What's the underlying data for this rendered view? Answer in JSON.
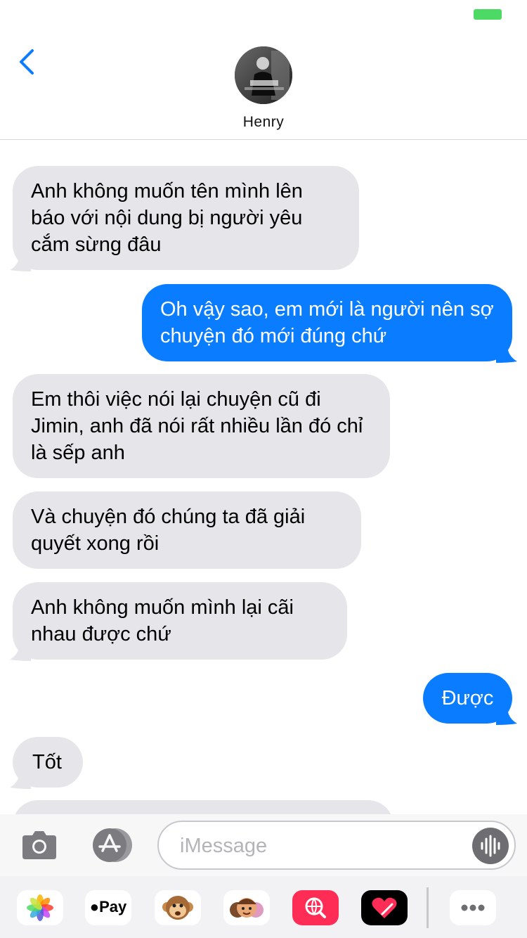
{
  "contact": {
    "name": "Henry"
  },
  "messages": [
    {
      "side": "in",
      "text": "Anh không muốn tên mình lên báo với nội dung bị người yêu cắm sừng đâu"
    },
    {
      "side": "out",
      "text": "Oh vậy sao, em mới là người nên sợ chuyện đó mới đúng chứ"
    },
    {
      "side": "in",
      "text": "Em thôi việc nói lại chuyện cũ đi Jimin, anh đã nói rất nhiều lần đó chỉ là sếp anh"
    },
    {
      "side": "in",
      "text": "Và chuyện đó chúng ta đã giải quyết xong rồi"
    },
    {
      "side": "in",
      "text": "Anh không muốn mình lại cãi nhau được chứ"
    },
    {
      "side": "out",
      "text": "Được"
    },
    {
      "side": "in",
      "text": "Tốt"
    }
  ],
  "composer": {
    "placeholder": "iMessage"
  },
  "drawer": {
    "apps": [
      {
        "name": "photos",
        "icon": "photos-icon"
      },
      {
        "name": "apple-pay",
        "icon": "apple-pay-icon",
        "label": "Pay"
      },
      {
        "name": "animoji",
        "icon": "monkey-animoji-icon"
      },
      {
        "name": "memoji-stickers",
        "icon": "memoji-stickers-icon"
      },
      {
        "name": "images-search",
        "icon": "globe-search-icon"
      },
      {
        "name": "digital-touch",
        "icon": "heart-touch-icon"
      },
      {
        "name": "more",
        "icon": "more-icon"
      }
    ]
  },
  "colors": {
    "incoming_bubble": "#e5e5ea",
    "outgoing_bubble": "#0a7cff",
    "accent": "#0a7cff",
    "battery": "#4cd964"
  }
}
